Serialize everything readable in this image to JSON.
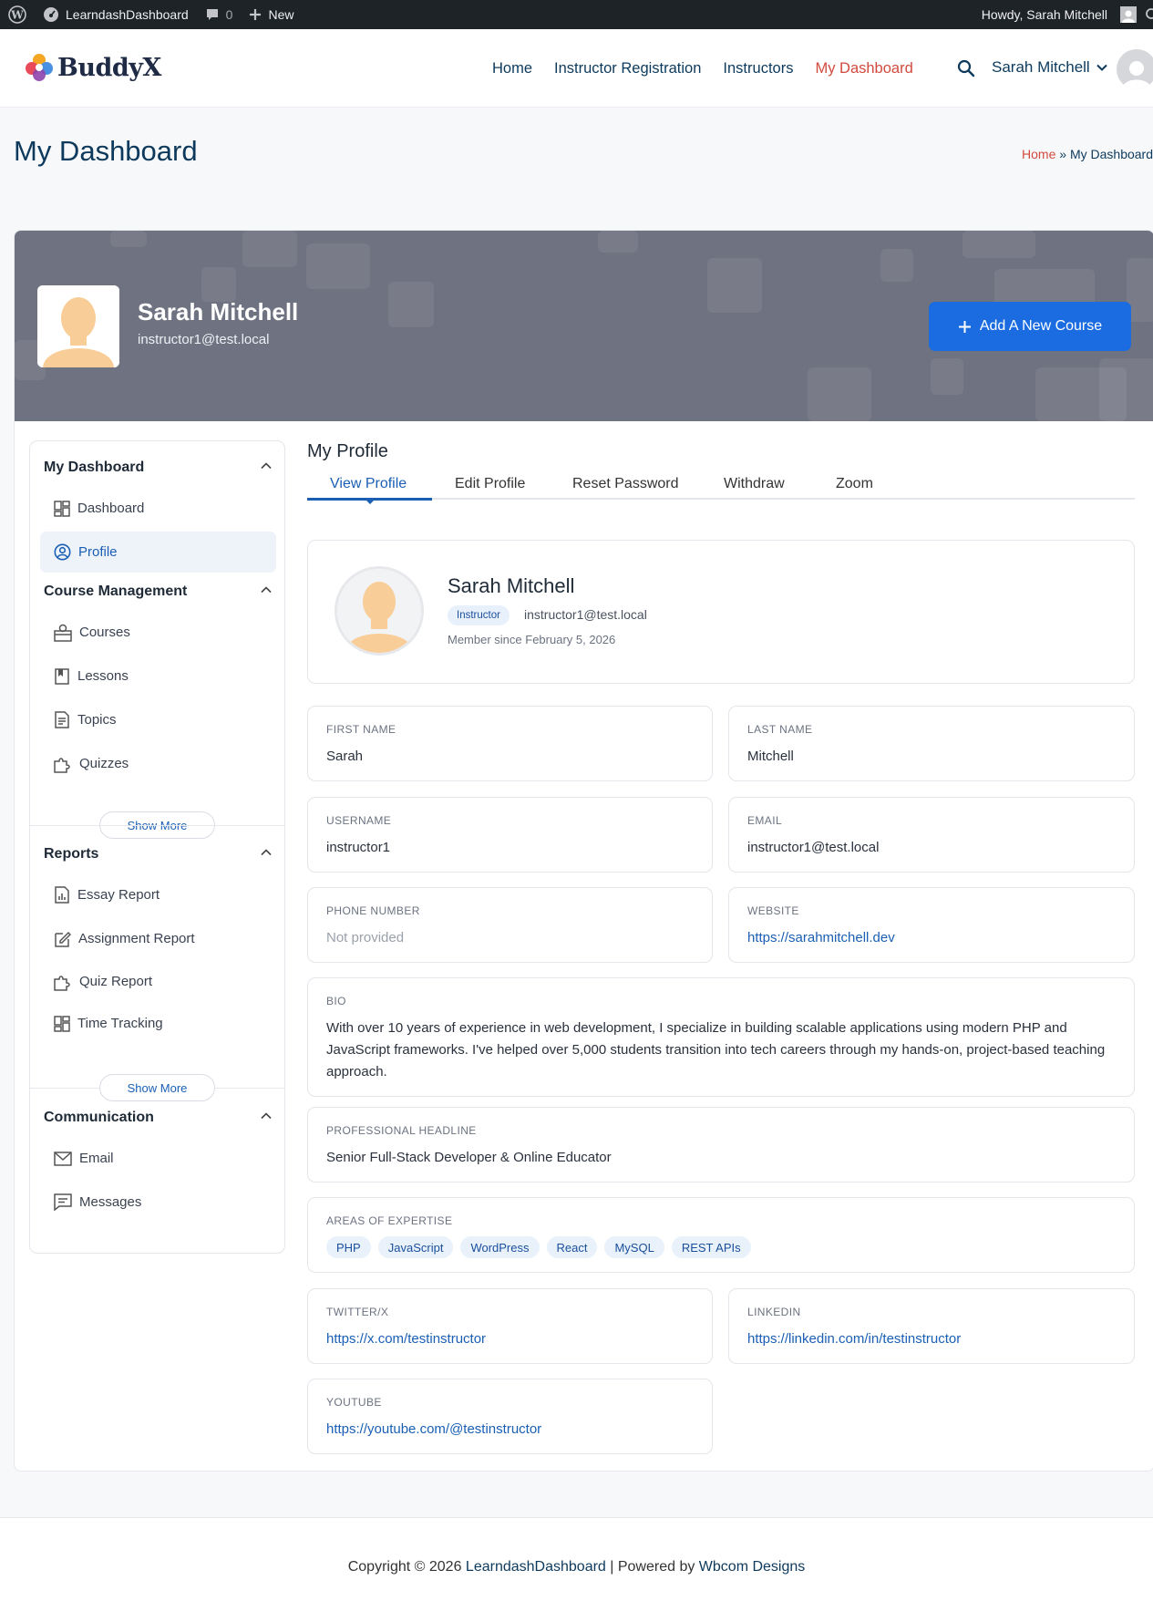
{
  "admin_bar": {
    "site_name": "LearndashDashboard",
    "comments_count": "0",
    "new_label": "New",
    "howdy": "Howdy, Sarah Mitchell"
  },
  "header": {
    "logo_text": "BuddyX",
    "nav": [
      "Home",
      "Instructor Registration",
      "Instructors",
      "My Dashboard"
    ],
    "user_name": "Sarah Mitchell"
  },
  "page": {
    "title": "My Dashboard",
    "breadcrumb_home": "Home",
    "breadcrumb_sep": "»",
    "breadcrumb_current": "My Dashboard"
  },
  "banner": {
    "name": "Sarah Mitchell",
    "email": "instructor1@test.local",
    "add_course_label": "Add A New Course"
  },
  "sidebar": {
    "dashboard_title": "My Dashboard",
    "dashboard_items": [
      "Dashboard",
      "Profile"
    ],
    "course_title": "Course Management",
    "course_items": [
      "Courses",
      "Lessons",
      "Topics",
      "Quizzes"
    ],
    "reports_title": "Reports",
    "reports_items": [
      "Essay Report",
      "Assignment Report",
      "Quiz Report",
      "Time Tracking"
    ],
    "communication_title": "Communication",
    "communication_items": [
      "Email",
      "Messages"
    ],
    "show_more": "Show More"
  },
  "content": {
    "title": "My Profile",
    "tabs": [
      "View Profile",
      "Edit Profile",
      "Reset Password",
      "Withdraw",
      "Zoom"
    ]
  },
  "profile": {
    "name": "Sarah Mitchell",
    "role": "Instructor",
    "email": "instructor1@test.local",
    "member_since": "Member since February 5, 2026"
  },
  "fields": {
    "first_name": {
      "label": "FIRST NAME",
      "value": "Sarah"
    },
    "last_name": {
      "label": "LAST NAME",
      "value": "Mitchell"
    },
    "username": {
      "label": "USERNAME",
      "value": "instructor1"
    },
    "email": {
      "label": "EMAIL",
      "value": "instructor1@test.local"
    },
    "phone": {
      "label": "PHONE NUMBER",
      "value": "Not provided"
    },
    "website": {
      "label": "WEBSITE",
      "value": "https://sarahmitchell.dev"
    },
    "bio": {
      "label": "BIO",
      "value": "With over 10 years of experience in web development, I specialize in building scalable applications using modern PHP and JavaScript frameworks. I've helped over 5,000 students transition into tech careers through my hands-on, project-based teaching approach."
    },
    "headline": {
      "label": "PROFESSIONAL HEADLINE",
      "value": "Senior Full-Stack Developer & Online Educator"
    },
    "expertise": {
      "label": "AREAS OF EXPERTISE",
      "values": [
        "PHP",
        "JavaScript",
        "WordPress",
        "React",
        "MySQL",
        "REST APIs"
      ]
    },
    "twitter": {
      "label": "TWITTER/X",
      "value": "https://x.com/testinstructor"
    },
    "linkedin": {
      "label": "LINKEDIN",
      "value": "https://linkedin.com/in/testinstructor"
    },
    "youtube": {
      "label": "YOUTUBE",
      "value": "https://youtube.com/@testinstructor"
    }
  },
  "footer": {
    "prefix": "Copyright © 2026 ",
    "site_link": "LearndashDashboard",
    "middle": " | Powered by ",
    "powered_link": "Wbcom Designs"
  },
  "colors": {
    "accent": "#1a6ce0",
    "nav_active": "#d14a3e",
    "admin_bar": "#1d2327",
    "banner": "#6f7280"
  }
}
